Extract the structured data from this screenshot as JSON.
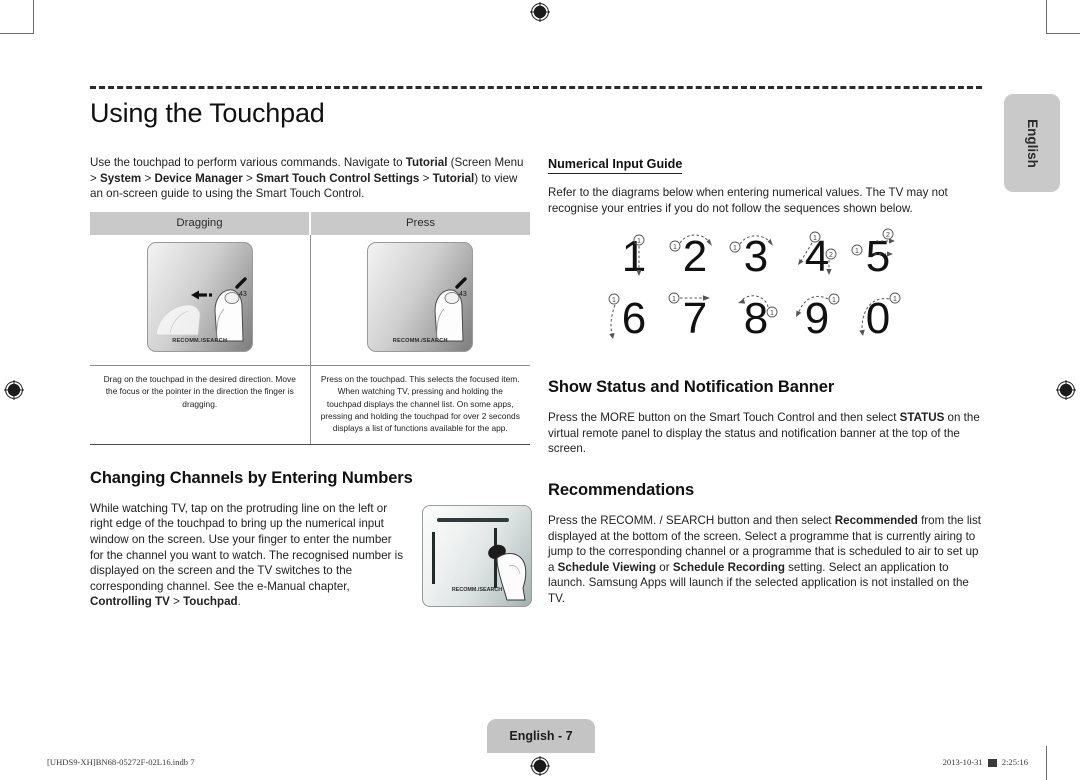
{
  "page": {
    "title": "Using the Touchpad",
    "language_tab": "English",
    "page_tab": "English - 7",
    "footer_left": "[UHDS9-XH]BN68-05272F-02L16.indb   7",
    "footer_date": "2013-10-31",
    "footer_time": "2:25:16"
  },
  "left": {
    "intro_html": "Use the touchpad to perform various commands. Navigate to <b>Tutorial</b> (Screen Menu &gt; <b>System</b> &gt; <b>Device Manager</b> &gt; <b>Smart Touch Control Settings</b> &gt; <b>Tutorial</b>) to view an on-screen guide to using the Smart Touch Control.",
    "table": {
      "headers": [
        "Dragging",
        "Press"
      ],
      "descriptions": [
        "Drag on the touchpad in the desired direction. Move the focus or the pointer in the direction the finger is dragging.",
        "Press on the touchpad. This selects the focused item. When watching TV, pressing and holding the touchpad displays the channel list. On some apps, pressing and holding the touchpad for over 2 seconds displays a list of functions available for the app."
      ],
      "touchpad_brand": "RECOMM./SEARCH"
    },
    "section2_heading": "Changing Channels by Entering Numbers",
    "section2_html": "While watching TV, tap on the protruding line on the left or right edge of the touchpad to bring up the numerical input window on the screen. Use your finger to enter the number for the channel you want to watch. The recognised number is displayed on the screen and the TV switches to the corresponding channel. See the e-Manual chapter, <b>Controlling TV</b> &gt; <b>Touchpad</b>.",
    "chan_pad_brand": "RECOMM./SEARCH"
  },
  "right": {
    "guide_heading": "Numerical Input Guide",
    "guide_html": "Refer to the diagrams below when entering numerical values. The TV may not recognise your entries if you do not follow the sequences shown below.",
    "numerals_row1": [
      "1",
      "2",
      "3",
      "4",
      "5"
    ],
    "numerals_row2": [
      "6",
      "7",
      "8",
      "9",
      "0"
    ],
    "stroke_markers": [
      "①",
      "②"
    ],
    "section_status_heading": "Show Status and Notification Banner",
    "section_status_html": "Press the MORE button on the Smart Touch Control and then select <b>STATUS</b> on the virtual remote panel to display the status and notification banner at the top of the screen.",
    "section_reco_heading": "Recommendations",
    "section_reco_html": "Press the RECOMM. / SEARCH button and then select <b>Recommended</b> from the list displayed at the bottom of the screen. Select a programme that is currently airing to jump to the corresponding channel or a programme that is scheduled to air to set up a <b>Schedule Viewing</b> or <b>Schedule Recording</b> setting. Select an application to launch. Samsung Apps will launch if the selected application is not installed on the TV."
  },
  "colors": {
    "header_band": "#c9c9c9",
    "tab_gray": "#c4c4c4",
    "text": "#1a1a1a",
    "rule": "#2b2b2b"
  }
}
